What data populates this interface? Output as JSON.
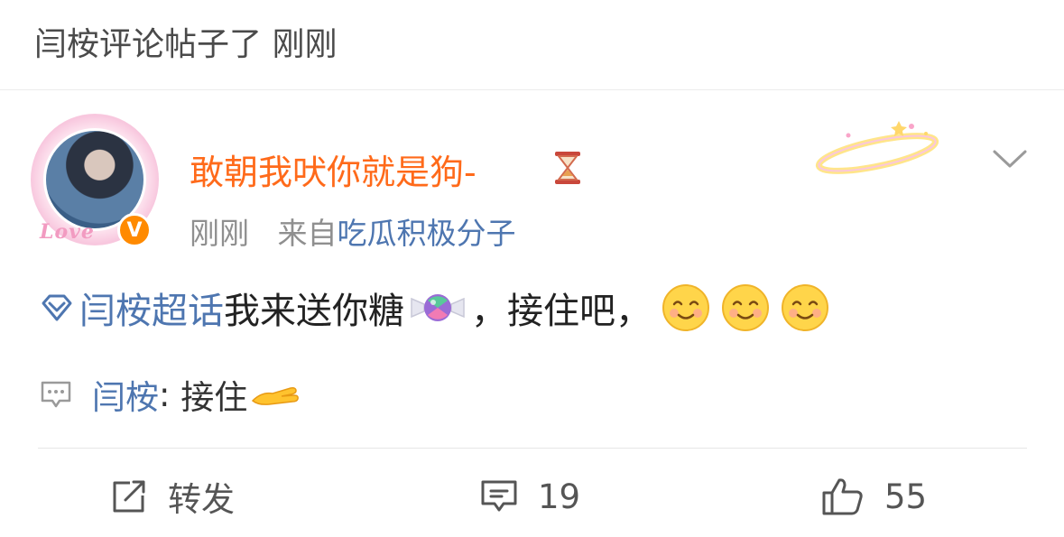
{
  "notice": {
    "text": "闫桉评论帖子了 刚刚"
  },
  "post": {
    "avatar": {
      "frame_text": "Love",
      "verified_icon": "verified-badge-icon",
      "verified_mark": "V"
    },
    "username": "敢朝我吠你就是狗-",
    "username_icon": "hourglass-icon",
    "decoration_icon": "halo-icon",
    "time": "刚刚",
    "source_prefix": "来自",
    "source": "吃瓜积极分子",
    "menu_icon": "chevron-down-icon",
    "content": {
      "topic_icon": "super-topic-diamond-icon",
      "topic": "闫桉超话",
      "text_before": " 我来送你糖",
      "candy_icon": "candy-emoji",
      "text_after": "，接住吧，",
      "emojis": [
        "smile-emoji",
        "smile-emoji",
        "smile-emoji"
      ]
    },
    "reply": {
      "icon": "comment-bubble-icon",
      "author": "闫桉",
      "separator": ": ",
      "text": "接住",
      "emoji": "offering-hand-emoji"
    }
  },
  "actions": {
    "repost": {
      "icon": "repost-icon",
      "label": "转发"
    },
    "comment": {
      "icon": "comment-icon",
      "count": "19"
    },
    "like": {
      "icon": "thumbs-up-icon",
      "count": "55"
    }
  },
  "colors": {
    "username": "#ff6a1a",
    "link": "#4e76b0",
    "muted": "#8f8f8f",
    "verified": "#ff8a00"
  }
}
